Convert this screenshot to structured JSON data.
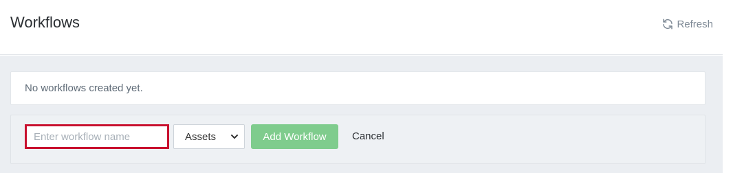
{
  "header": {
    "title": "Workflows",
    "refresh_label": "Refresh",
    "refresh_icon": "refresh-icon"
  },
  "empty_state": {
    "message": "No workflows created yet."
  },
  "form": {
    "name_input": {
      "value": "",
      "placeholder": "Enter workflow name"
    },
    "type_select": {
      "selected": "Assets",
      "icon": "chevron-down-icon"
    },
    "add_button_label": "Add Workflow",
    "cancel_label": "Cancel"
  },
  "colors": {
    "focus_border": "#c8102e",
    "add_button_bg": "#7fcc8d",
    "body_bg": "#ebeef2"
  }
}
